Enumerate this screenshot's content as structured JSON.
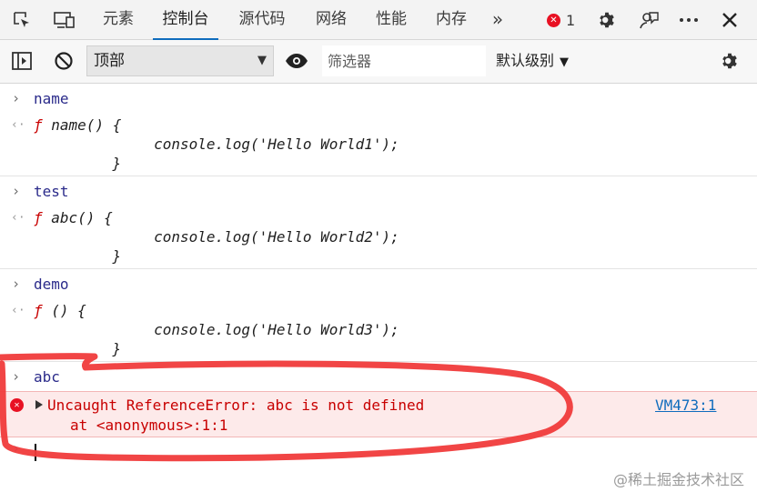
{
  "tabs": [
    "元素",
    "控制台",
    "源代码",
    "网络",
    "性能",
    "内存"
  ],
  "active_tab": "控制台",
  "more_tabs_glyph": "»",
  "error_count": "1",
  "toolbar": {
    "context": "顶部",
    "filter_placeholder": "筛选器",
    "level": "默认级别"
  },
  "console": {
    "entries": [
      {
        "input": "name",
        "output": [
          "ƒ name() {",
          "        console.log('Hello World1');",
          "    }"
        ]
      },
      {
        "input": "test",
        "output": [
          "ƒ abc() {",
          "        console.log('Hello World2');",
          "    }"
        ]
      },
      {
        "input": "demo",
        "output": [
          "ƒ () {",
          "        console.log('Hello World3');",
          "    }"
        ]
      }
    ],
    "error_input": "abc",
    "error": {
      "message": "Uncaught ReferenceError: abc is not defined",
      "stack": "at <anonymous>:1:1",
      "source": "VM473:1"
    }
  },
  "watermark": "@稀土掘金技术社区",
  "icons": {
    "inspect": "inspect-element-icon",
    "device": "device-emulation-icon",
    "sidebar": "show-sidebar-icon",
    "clear": "clear-console-icon",
    "eye": "live-expression-icon",
    "settings": "gear-icon",
    "feedback": "feedback-icon",
    "more": "more-options-icon",
    "close": "close-icon"
  },
  "colors": {
    "accent": "#0f6cbd",
    "error": "#e81123",
    "error_text": "#c80000",
    "error_bg": "#fdeaea"
  }
}
